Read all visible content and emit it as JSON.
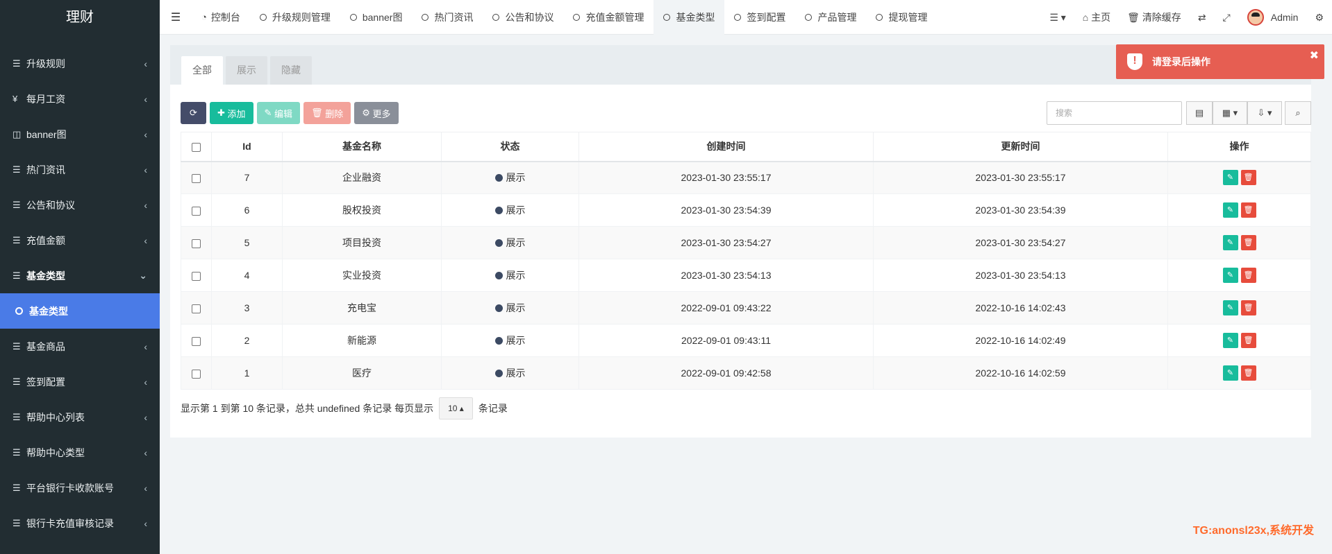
{
  "brand": "理财",
  "sidebar": {
    "items": [
      {
        "label": "升级规则",
        "icon": "list-icon"
      },
      {
        "label": "每月工资",
        "icon": "yen-icon"
      },
      {
        "label": "banner图",
        "icon": "columns-icon"
      },
      {
        "label": "热门资讯",
        "icon": "list-icon"
      },
      {
        "label": "公告和协议",
        "icon": "list-icon"
      },
      {
        "label": "充值金额",
        "icon": "list-icon"
      },
      {
        "label": "基金类型",
        "icon": "list-icon"
      },
      {
        "label": "基金类型",
        "icon": "circle-icon"
      },
      {
        "label": "基金商品",
        "icon": "list-icon"
      },
      {
        "label": "签到配置",
        "icon": "list-icon"
      },
      {
        "label": "帮助中心列表",
        "icon": "list-icon"
      },
      {
        "label": "帮助中心类型",
        "icon": "list-icon"
      },
      {
        "label": "平台银行卡收款账号",
        "icon": "list-icon"
      },
      {
        "label": "银行卡充值审核记录",
        "icon": "list-icon"
      }
    ]
  },
  "topnav": {
    "tabs": [
      "控制台",
      "升级规则管理",
      "banner图",
      "热门资讯",
      "公告和协议",
      "充值金额管理",
      "基金类型",
      "签到配置",
      "产品管理",
      "提现管理"
    ],
    "home": "主页",
    "clear_cache": "清除缓存",
    "user": "Admin"
  },
  "panel": {
    "tabs": [
      "全部",
      "展示",
      "隐藏"
    ],
    "toolbar": {
      "add": "添加",
      "edit": "编辑",
      "delete": "删除",
      "more": "更多"
    },
    "search_placeholder": "搜索"
  },
  "toast": {
    "message": "请登录后操作"
  },
  "table": {
    "headers": [
      "Id",
      "基金名称",
      "状态",
      "创建时间",
      "更新时间",
      "操作"
    ],
    "rows": [
      {
        "id": "7",
        "name": "企业融资",
        "status": "展示",
        "created": "2023-01-30 23:55:17",
        "updated": "2023-01-30 23:55:17"
      },
      {
        "id": "6",
        "name": "股权投资",
        "status": "展示",
        "created": "2023-01-30 23:54:39",
        "updated": "2023-01-30 23:54:39"
      },
      {
        "id": "5",
        "name": "项目投资",
        "status": "展示",
        "created": "2023-01-30 23:54:27",
        "updated": "2023-01-30 23:54:27"
      },
      {
        "id": "4",
        "name": "实业投资",
        "status": "展示",
        "created": "2023-01-30 23:54:13",
        "updated": "2023-01-30 23:54:13"
      },
      {
        "id": "3",
        "name": "充电宝",
        "status": "展示",
        "created": "2022-09-01 09:43:22",
        "updated": "2022-10-16 14:02:43"
      },
      {
        "id": "2",
        "name": "新能源",
        "status": "展示",
        "created": "2022-09-01 09:43:11",
        "updated": "2022-10-16 14:02:49"
      },
      {
        "id": "1",
        "name": "医疗",
        "status": "展示",
        "created": "2022-09-01 09:42:58",
        "updated": "2022-10-16 14:02:59"
      }
    ]
  },
  "pagination": {
    "summary": "显示第 1 到第 10 条记录，总共 undefined 条记录 每页显示",
    "page_size": "10",
    "suffix": "条记录"
  },
  "watermark": "TG:anonsl23x,系统开发"
}
